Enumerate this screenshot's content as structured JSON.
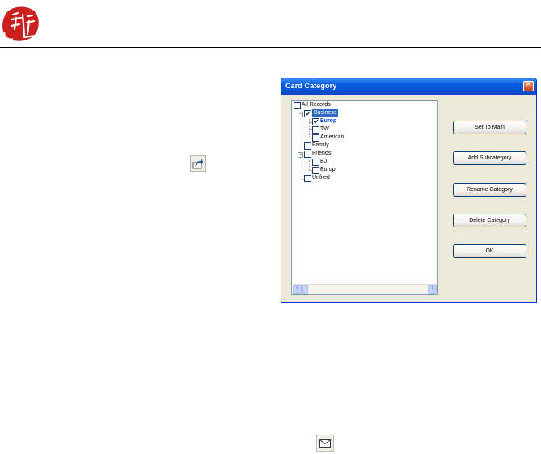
{
  "dialog": {
    "title": "Card Category",
    "close_glyph": "✕"
  },
  "tree": {
    "items": [
      {
        "label": "All Records",
        "checked": false
      },
      {
        "label": "Business",
        "checked": true,
        "selected": true
      },
      {
        "label": "Europ",
        "checked": true,
        "bold": true
      },
      {
        "label": "TW",
        "checked": false
      },
      {
        "label": "American",
        "checked": false
      },
      {
        "label": "Family",
        "checked": false
      },
      {
        "label": "Friends",
        "checked": false
      },
      {
        "label": "BJ",
        "checked": false
      },
      {
        "label": "Europ",
        "checked": false
      },
      {
        "label": "Unfiled",
        "checked": false
      }
    ],
    "expander_glyph": "−",
    "scroll_left_glyph": "‹",
    "scroll_right_glyph": "›"
  },
  "buttons": {
    "set_to_main": "Set To Main",
    "add_subcategory": "Add Subcategory",
    "rename_category": "Rename Category",
    "delete_category": "Delete Category",
    "ok": "OK"
  },
  "icons": {
    "logo": "red-seal-logo-icon",
    "export": "export-arrow-icon",
    "mail": "envelope-icon"
  },
  "colors": {
    "titlebar": "#0a5fe0",
    "selection": "#316ac5",
    "dialog_bg": "#ece9d8",
    "seal_red": "#cc1f1f"
  }
}
